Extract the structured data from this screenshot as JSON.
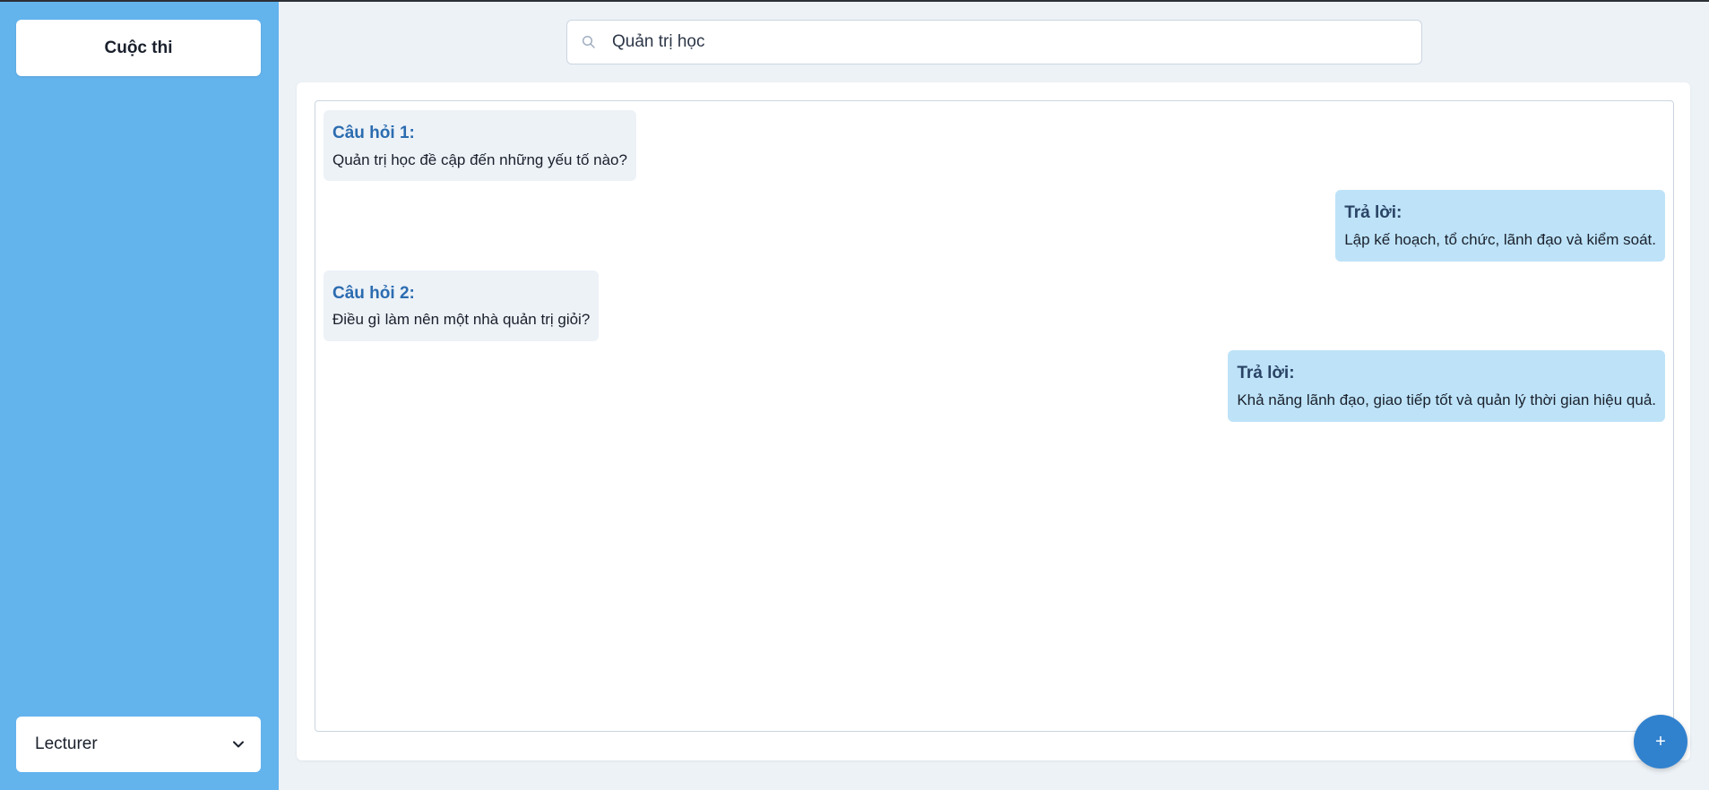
{
  "sidebar": {
    "title": "Cuộc thi",
    "role_select": {
      "value": "Lecturer"
    }
  },
  "search": {
    "value": "Quản trị học",
    "icon": "search-icon"
  },
  "messages": [
    {
      "type": "question",
      "label": "Câu hỏi 1:",
      "text": "Quản trị học đề cập đến những yếu tố nào?"
    },
    {
      "type": "answer",
      "label": "Trả lời:",
      "text": "Lập kế hoạch, tổ chức, lãnh đạo và kiểm soát."
    },
    {
      "type": "question",
      "label": "Câu hỏi 2:",
      "text": "Điều gì làm nên một nhà quản trị giỏi?"
    },
    {
      "type": "answer",
      "label": "Trả lời:",
      "text": "Khả năng lãnh đạo, giao tiếp tốt và quản lý thời gian hiệu quả."
    }
  ],
  "fab": {
    "label": "+"
  },
  "colors": {
    "sidebar_bg": "#63b3ed",
    "question_bg": "#edf2f7",
    "answer_bg": "#bee3f8",
    "question_label": "#2b6cb0",
    "fab_bg": "#3182ce"
  }
}
